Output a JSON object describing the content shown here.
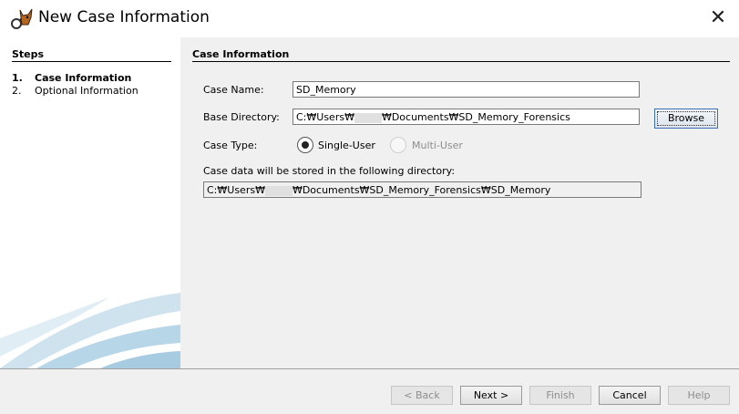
{
  "window": {
    "title": "New Case Information",
    "close_glyph": "✕"
  },
  "steps": {
    "heading": "Steps",
    "items": [
      {
        "num": "1.",
        "label": "Case Information",
        "active": true
      },
      {
        "num": "2.",
        "label": "Optional Information",
        "active": false
      }
    ]
  },
  "case_info": {
    "heading": "Case Information",
    "case_name_label": "Case Name:",
    "case_name_value": "SD_Memory",
    "base_dir_label": "Base Directory:",
    "base_dir_prefix": "C:₩Users₩",
    "base_dir_suffix": "₩Documents₩SD_Memory_Forensics",
    "browse_label": "Browse",
    "case_type_label": "Case Type:",
    "single_user_label": "Single-User",
    "multi_user_label": "Multi-User",
    "case_type_selected": "Single-User",
    "storage_note": "Case data will be stored in the following directory:",
    "storage_prefix": "C:₩Users₩",
    "storage_suffix": "₩Documents₩SD_Memory_Forensics₩SD_Memory"
  },
  "footer": {
    "back": "< Back",
    "next": "Next >",
    "finish": "Finish",
    "cancel": "Cancel",
    "help": "Help"
  },
  "icons": {
    "app_icon": "autopsy-dog-icon",
    "close_icon": "close-icon"
  }
}
